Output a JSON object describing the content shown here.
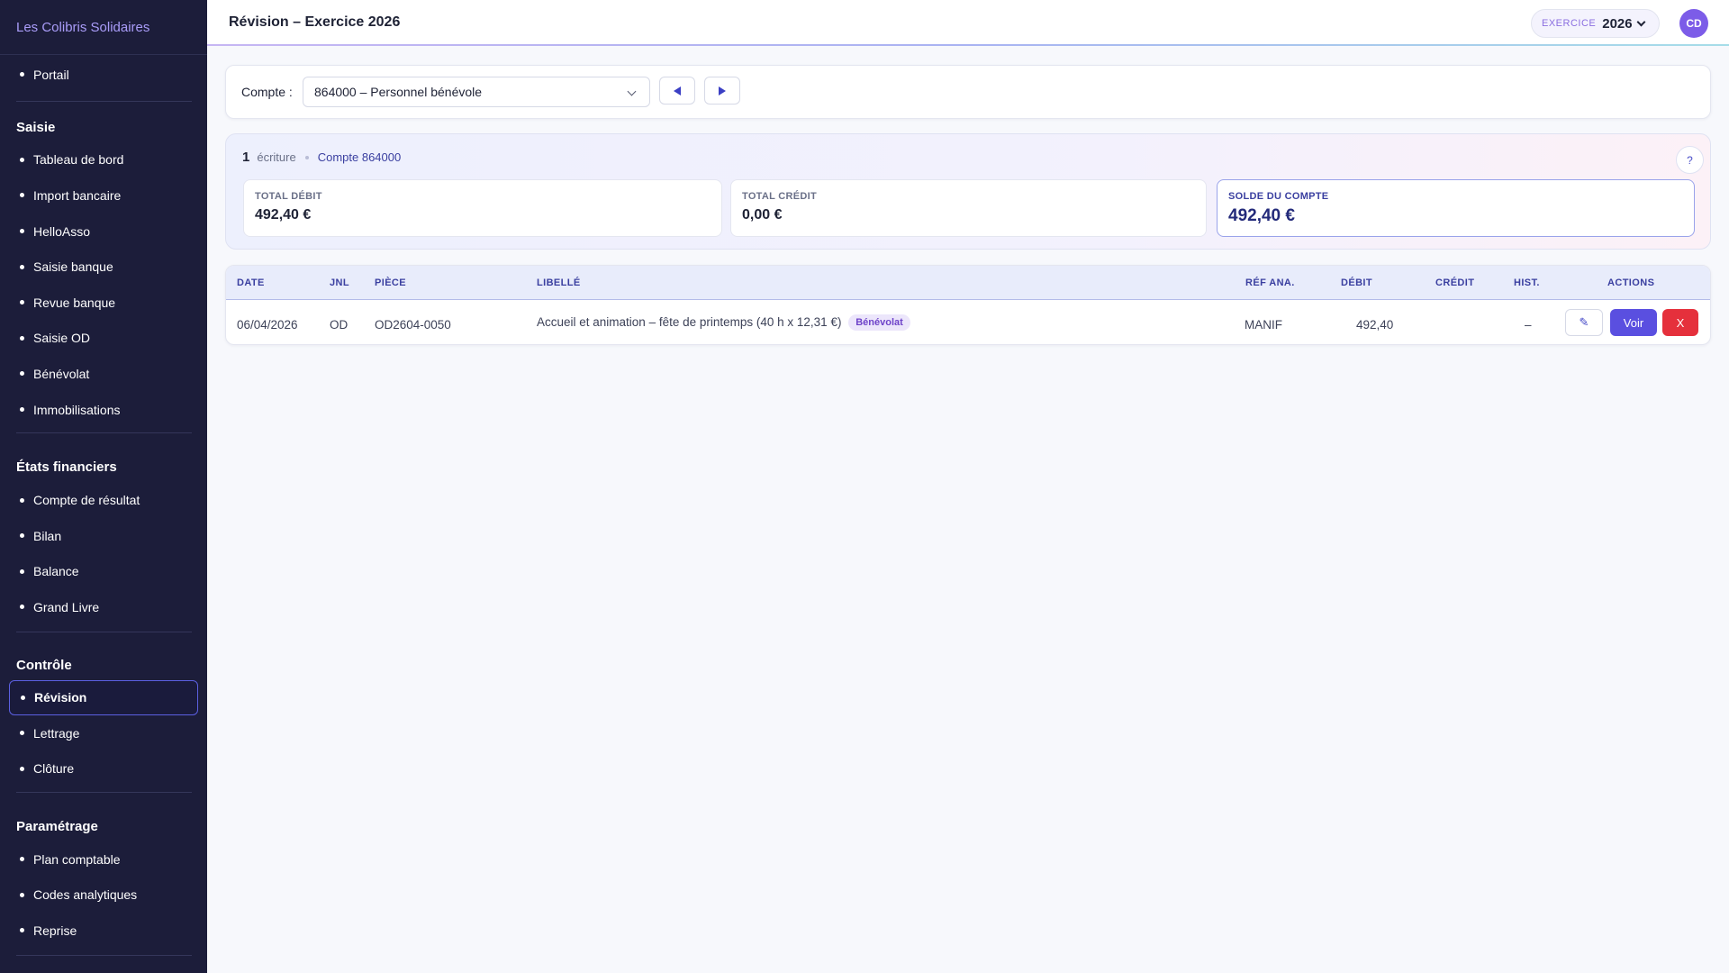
{
  "app": {
    "brand": "Les Colibris Solidaires"
  },
  "sidebar": {
    "top_items": [
      "Portail"
    ],
    "sections": [
      {
        "title": "Saisie",
        "items": [
          "Tableau de bord",
          "Import bancaire",
          "HelloAsso",
          "Saisie banque",
          "Revue banque",
          "Saisie OD",
          "Bénévolat",
          "Immobilisations"
        ]
      },
      {
        "title": "États financiers",
        "items": [
          "Compte de résultat",
          "Bilan",
          "Balance",
          "Grand Livre"
        ]
      },
      {
        "title": "Contrôle",
        "items": [
          "Révision",
          "Lettrage",
          "Clôture"
        ],
        "active": "Révision"
      },
      {
        "title": "Paramétrage",
        "items": [
          "Plan comptable",
          "Codes analytiques",
          "Reprise"
        ]
      }
    ]
  },
  "header": {
    "title": "Révision – Exercice 2026",
    "exercise_label": "EXERCICE",
    "exercise_year": "2026",
    "avatar_initials": "CD"
  },
  "account_selector": {
    "label": "Compte :",
    "value": "864000 – Personnel bénévole"
  },
  "summary": {
    "count": "1",
    "count_word": "écriture",
    "account": "Compte 864000",
    "help": "?",
    "total_debit_label": "TOTAL DÉBIT",
    "total_debit": "492,40 €",
    "total_credit_label": "TOTAL CRÉDIT",
    "total_credit": "0,00 €",
    "solde_label": "SOLDE DU COMPTE",
    "solde": "492,40 €"
  },
  "table": {
    "headers": {
      "date": "DATE",
      "jnl": "JNL",
      "piece": "PIÈCE",
      "libelle": "LIBELLÉ",
      "ref": "RÉF ANA.",
      "debit": "DÉBIT",
      "credit": "CRÉDIT",
      "hist": "HIST.",
      "actions": "ACTIONS"
    },
    "rows": [
      {
        "date": "06/04/2026",
        "jnl": "OD",
        "piece": "OD2604-0050",
        "libelle": "Accueil et animation – fête de printemps (40 h x 12,31 €)",
        "tag": "Bénévolat",
        "ref": "MANIF",
        "debit": "492,40",
        "credit": "",
        "hist": "–",
        "edit_label": "✎",
        "view_label": "Voir",
        "delete_label": "X"
      }
    ]
  },
  "colors": {
    "sidebar_bg": "#1c1d3a",
    "accent": "#5a4fe0",
    "danger": "#e5303c",
    "brand": "#a99cf8"
  }
}
